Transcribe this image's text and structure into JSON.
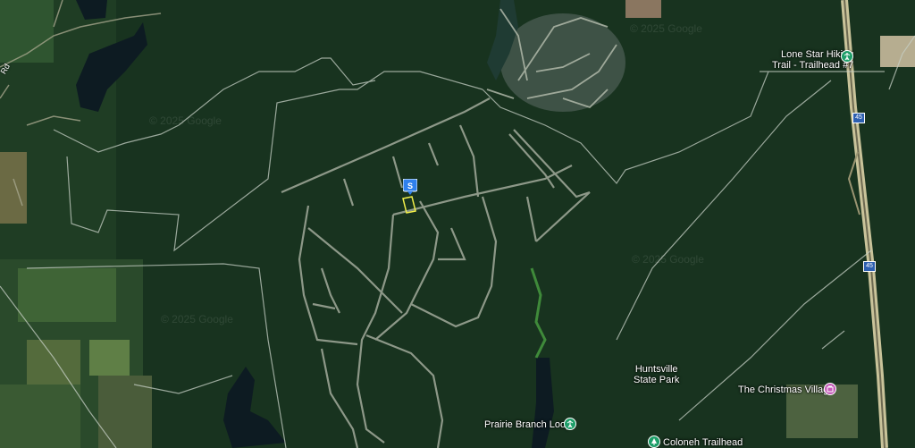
{
  "map": {
    "type": "satellite",
    "watermark": "© 2025 Google",
    "road_fragment": "Rd",
    "selected_marker": {
      "letter": "S",
      "color": "#2f80ed"
    },
    "parcel_outline_color": "#f3f04a"
  },
  "places": [
    {
      "id": "lone-star",
      "line1": "Lone Star Hiking",
      "line2": "Trail - Trailhead #7",
      "icon": "hiking-icon",
      "color": "#1e9e69"
    },
    {
      "id": "huntsville",
      "line1": "Huntsville",
      "line2": "State Park",
      "icon": "park-icon",
      "color": "#1e9e69"
    },
    {
      "id": "christmas",
      "line1": "The Christmas Village",
      "icon": "shopping-icon",
      "color": "#c45bb8"
    },
    {
      "id": "prairie",
      "line1": "Prairie Branch Loop",
      "icon": "hiking-icon",
      "color": "#1e9e69"
    },
    {
      "id": "coloneh",
      "line1": "Coloneh Trailhead",
      "icon": "park-icon",
      "color": "#1e9e69"
    }
  ],
  "highway": {
    "shield": "45"
  }
}
